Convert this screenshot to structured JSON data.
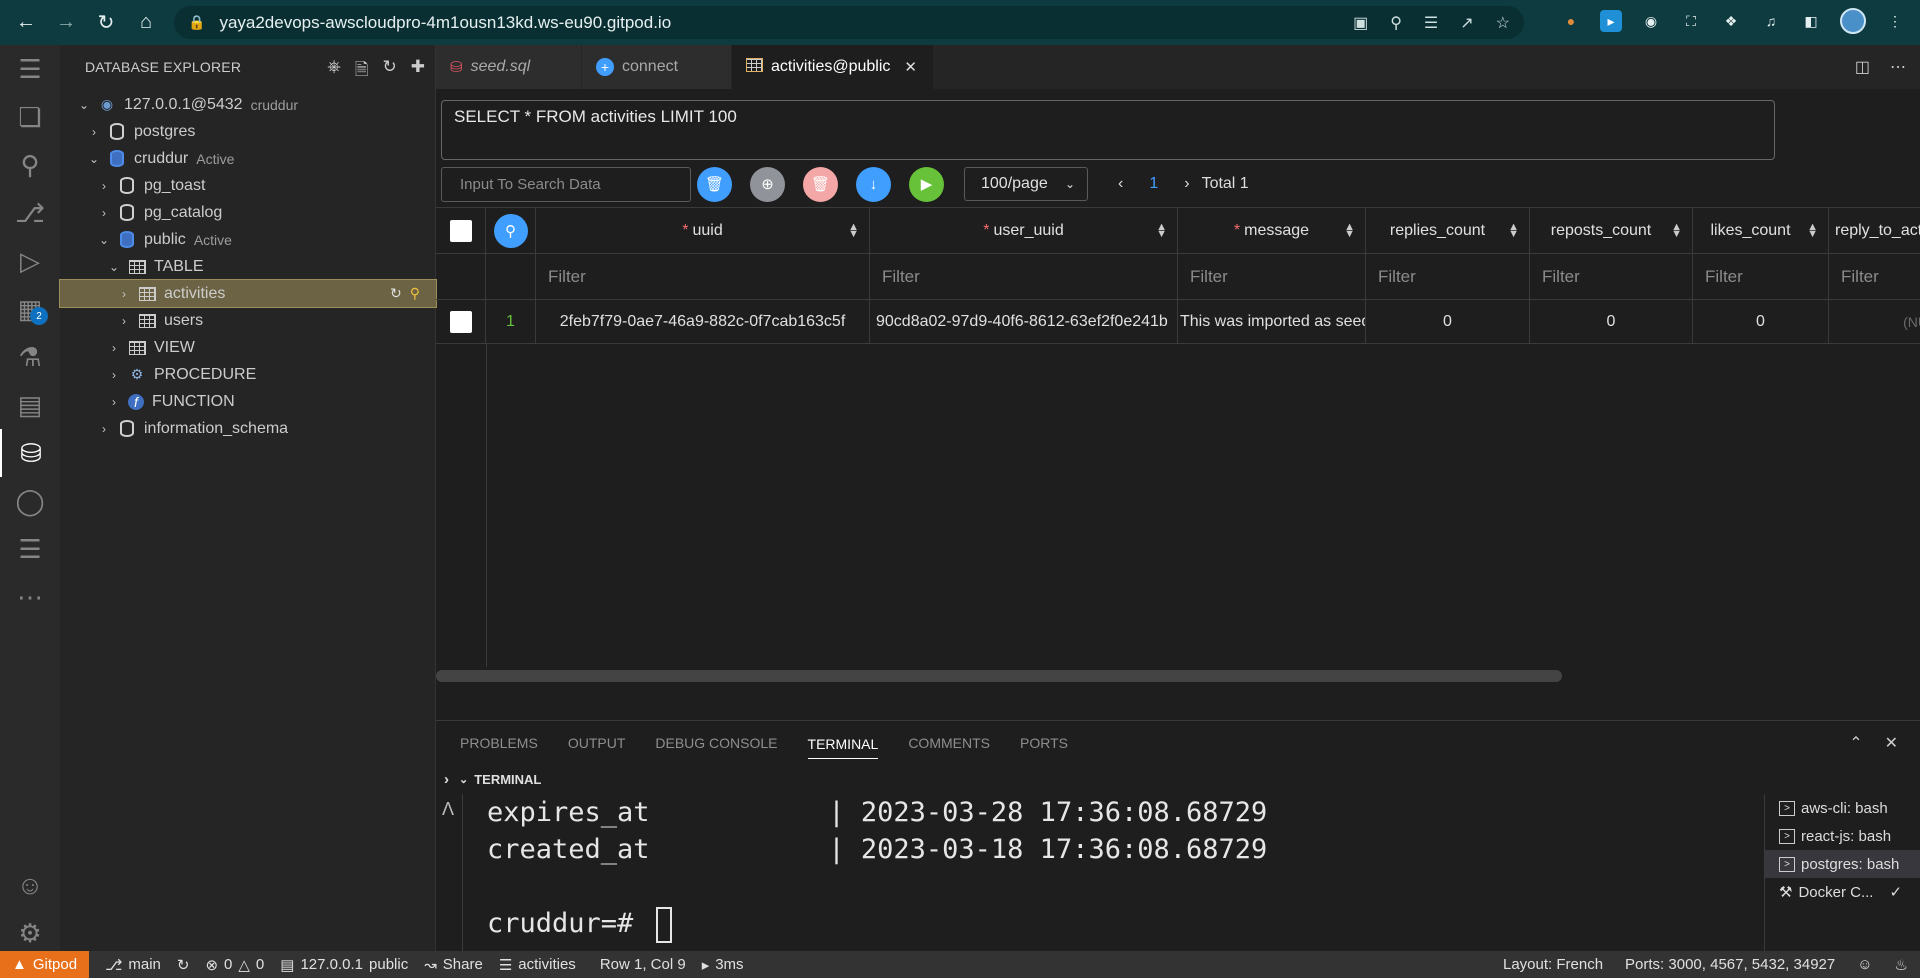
{
  "browser": {
    "url": "yaya2devops-awscloudpro-4m1ousn13kd.ws-eu90.gitpod.io"
  },
  "activity_bar": {
    "extensions_badge": "2"
  },
  "sidebar": {
    "title": "DATABASE EXPLORER",
    "tree": {
      "connection": "127.0.0.1@5432",
      "connection_db": "cruddur",
      "db_postgres": "postgres",
      "db_cruddur": "cruddur",
      "active_label": "Active",
      "schema_pg_toast": "pg_toast",
      "schema_pg_catalog": "pg_catalog",
      "schema_public": "public",
      "group_table": "TABLE",
      "table_activities": "activities",
      "table_users": "users",
      "group_view": "VIEW",
      "group_procedure": "PROCEDURE",
      "group_function": "FUNCTION",
      "schema_information": "information_schema"
    }
  },
  "tabs": [
    {
      "label": "seed.sql"
    },
    {
      "label": "connect"
    },
    {
      "label": "activities@public"
    }
  ],
  "query": "SELECT * FROM activities LIMIT 100",
  "toolbar": {
    "search_placeholder": "Input To Search Data",
    "page_size": "100/page",
    "current_page": "1",
    "total": "Total 1"
  },
  "grid": {
    "columns": [
      "uuid",
      "user_uuid",
      "message",
      "replies_count",
      "reposts_count",
      "likes_count",
      "reply_to_acti"
    ],
    "filter_placeholder": "Filter",
    "rows": [
      {
        "index": "1",
        "uuid": "2feb7f79-0ae7-46a9-882c-0f7cab163c5f",
        "user_uuid": "90cd8a02-97d9-40f6-8612-63ef2f0e241b",
        "message": "This was imported as seed",
        "replies_count": "0",
        "reposts_count": "0",
        "likes_count": "0",
        "reply_to": "(NU"
      }
    ]
  },
  "panel": {
    "tabs": [
      "PROBLEMS",
      "OUTPUT",
      "DEBUG CONSOLE",
      "TERMINAL",
      "COMMENTS",
      "PORTS"
    ],
    "section_title": "TERMINAL",
    "terminal_lines": [
      "expires_at           | 2023-03-28 17:36:08.68729",
      "created_at           | 2023-03-18 17:36:08.68729",
      ""
    ],
    "prompt": "cruddur=# ",
    "terminals": [
      "aws-cli: bash",
      "react-js: bash",
      "postgres: bash",
      "Docker C..."
    ]
  },
  "status_bar": {
    "gitpod": "Gitpod",
    "branch": "main",
    "errors": "0",
    "warnings": "0",
    "db_conn": "127.0.0.1",
    "db_schema": "public",
    "share": "Share",
    "table": "activities",
    "cursor_pos": "Row 1, Col 9",
    "timing": "3ms",
    "layout": "Layout: French",
    "ports": "Ports: 3000, 4567, 5432, 34927"
  },
  "colors": {
    "chrome_bg": "#0d3b3f",
    "accent_blue": "#409eff",
    "delete_pink": "#f4a7a7",
    "run_green": "#67c23a",
    "gitpod_orange": "#e8701a",
    "selection": "#6b6343"
  }
}
